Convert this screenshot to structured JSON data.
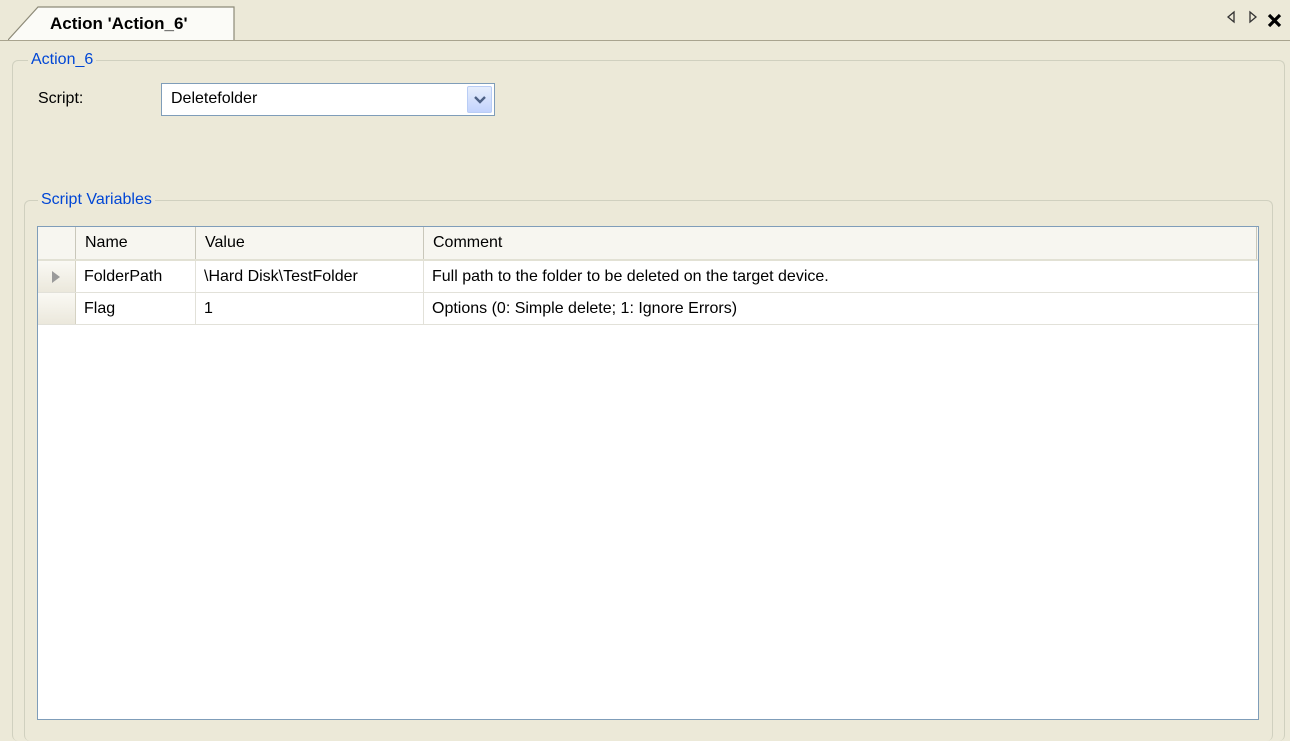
{
  "tab": {
    "title": "Action 'Action_6'",
    "prev_icon": "scroll-left-icon",
    "next_icon": "scroll-right-icon",
    "close_icon": "close-icon"
  },
  "action_group": {
    "title": "Action_6",
    "script_label": "Script:",
    "script_value": "Deletefolder",
    "dropdown_icon": "chevron-down-icon"
  },
  "variables_group": {
    "title": "Script Variables",
    "columns": [
      "Name",
      "Value",
      "Comment"
    ],
    "rows": [
      {
        "name": "FolderPath",
        "value": "\\Hard Disk\\TestFolder",
        "comment": "Full path to the folder to be deleted on the target device.",
        "current": true
      },
      {
        "name": "Flag",
        "value": "1",
        "comment": "Options (0: Simple delete; 1: Ignore Errors)",
        "current": false
      }
    ]
  },
  "colors": {
    "background": "#ece9d8",
    "group_title": "#0046d5",
    "border": "#7f9db9"
  }
}
